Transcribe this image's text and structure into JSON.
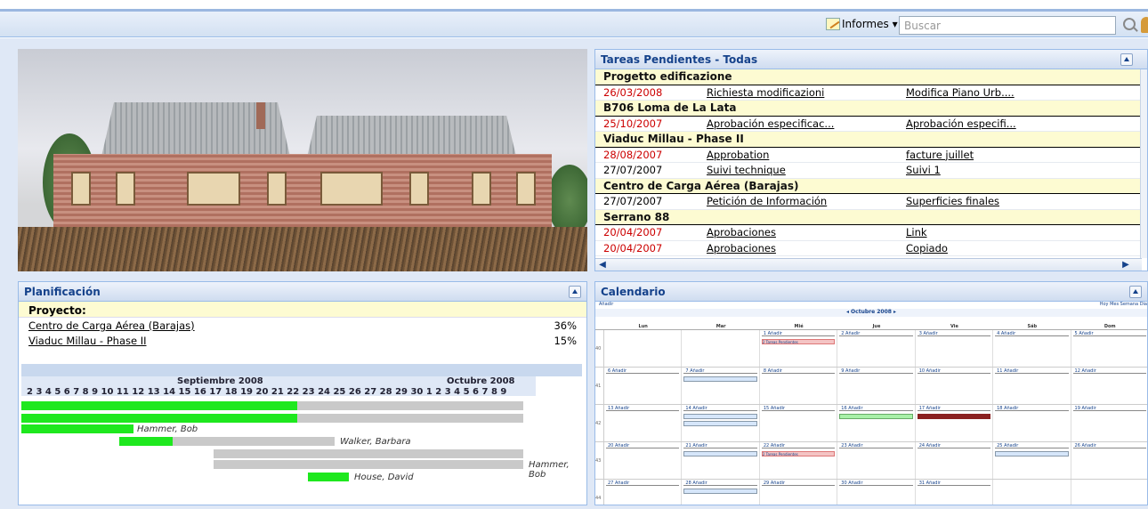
{
  "toolbar": {
    "reports_label": "Informes ▾",
    "search_placeholder": "Buscar"
  },
  "tareas": {
    "title": "Tareas Pendientes - Todas",
    "groups": [
      {
        "name": "Progetto edificazione",
        "items": [
          {
            "date": "26/03/2008",
            "overdue": true,
            "task": "Richiesta modificazioni",
            "doc": "Modifica Piano Urb...."
          }
        ]
      },
      {
        "name": "B706 Loma de La Lata",
        "items": [
          {
            "date": "25/10/2007",
            "overdue": true,
            "task": "Aprobación especificac...",
            "doc": "Aprobación especifi..."
          }
        ]
      },
      {
        "name": "Viaduc Millau - Phase II",
        "items": [
          {
            "date": "28/08/2007",
            "overdue": true,
            "task": "Approbation",
            "doc": "facture juillet"
          },
          {
            "date": "27/07/2007",
            "overdue": false,
            "task": "Suivi technique",
            "doc": "Suivi 1"
          }
        ]
      },
      {
        "name": "Centro de Carga Aérea (Barajas)",
        "items": [
          {
            "date": "27/07/2007",
            "overdue": false,
            "task": "Petición de Información",
            "doc": "Superficies finales"
          }
        ]
      },
      {
        "name": "Serrano 88",
        "items": [
          {
            "date": "20/04/2007",
            "overdue": true,
            "task": "Aprobaciones",
            "doc": "Link"
          },
          {
            "date": "20/04/2007",
            "overdue": true,
            "task": "Aprobaciones",
            "doc": "Copiado"
          }
        ]
      }
    ]
  },
  "plan": {
    "title": "Planificación",
    "header": "Proyecto:",
    "projects": [
      {
        "name": "Centro de Carga Aérea (Barajas)",
        "pct": "36%"
      },
      {
        "name": "Viaduc Millau - Phase II",
        "pct": "15%"
      }
    ],
    "months": [
      "Septiembre 2008",
      "Octubre 2008"
    ],
    "days": "2 3 4 5 6 7 8 9 10 11 12 13 14 15 16 17 18 19 20 21 22 23 24 25 26 27 28 29 30 1 2 3 4 5 6 7 8 9",
    "people": [
      "Hammer, Bob",
      "Walker, Barbara",
      "Hammer, Bob",
      "House, David"
    ]
  },
  "cal": {
    "title": "Calendario",
    "add_label": "Añadir",
    "month": "◂ Octubre 2008 ▸",
    "view_labels": "Hoy  Mes  Semana  Día",
    "weekdays": [
      "Lun",
      "Mar",
      "Mié",
      "Jue",
      "Vie",
      "Sáb",
      "Dom"
    ],
    "weeks": [
      {
        "n": "40",
        "days": [
          "",
          "",
          "1",
          "2",
          "3",
          "4",
          "5"
        ]
      },
      {
        "n": "41",
        "days": [
          "6",
          "7",
          "8",
          "9",
          "10",
          "11",
          "12"
        ]
      },
      {
        "n": "42",
        "days": [
          "13",
          "14",
          "15",
          "16",
          "17",
          "18",
          "19"
        ]
      },
      {
        "n": "43",
        "days": [
          "20",
          "21",
          "22",
          "23",
          "24",
          "25",
          "26"
        ]
      },
      {
        "n": "44",
        "days": [
          "27",
          "28",
          "29",
          "30",
          "31",
          "",
          ""
        ]
      }
    ],
    "day_add": "Añadir",
    "event_tasks": "2 Tareas Pendientes"
  }
}
